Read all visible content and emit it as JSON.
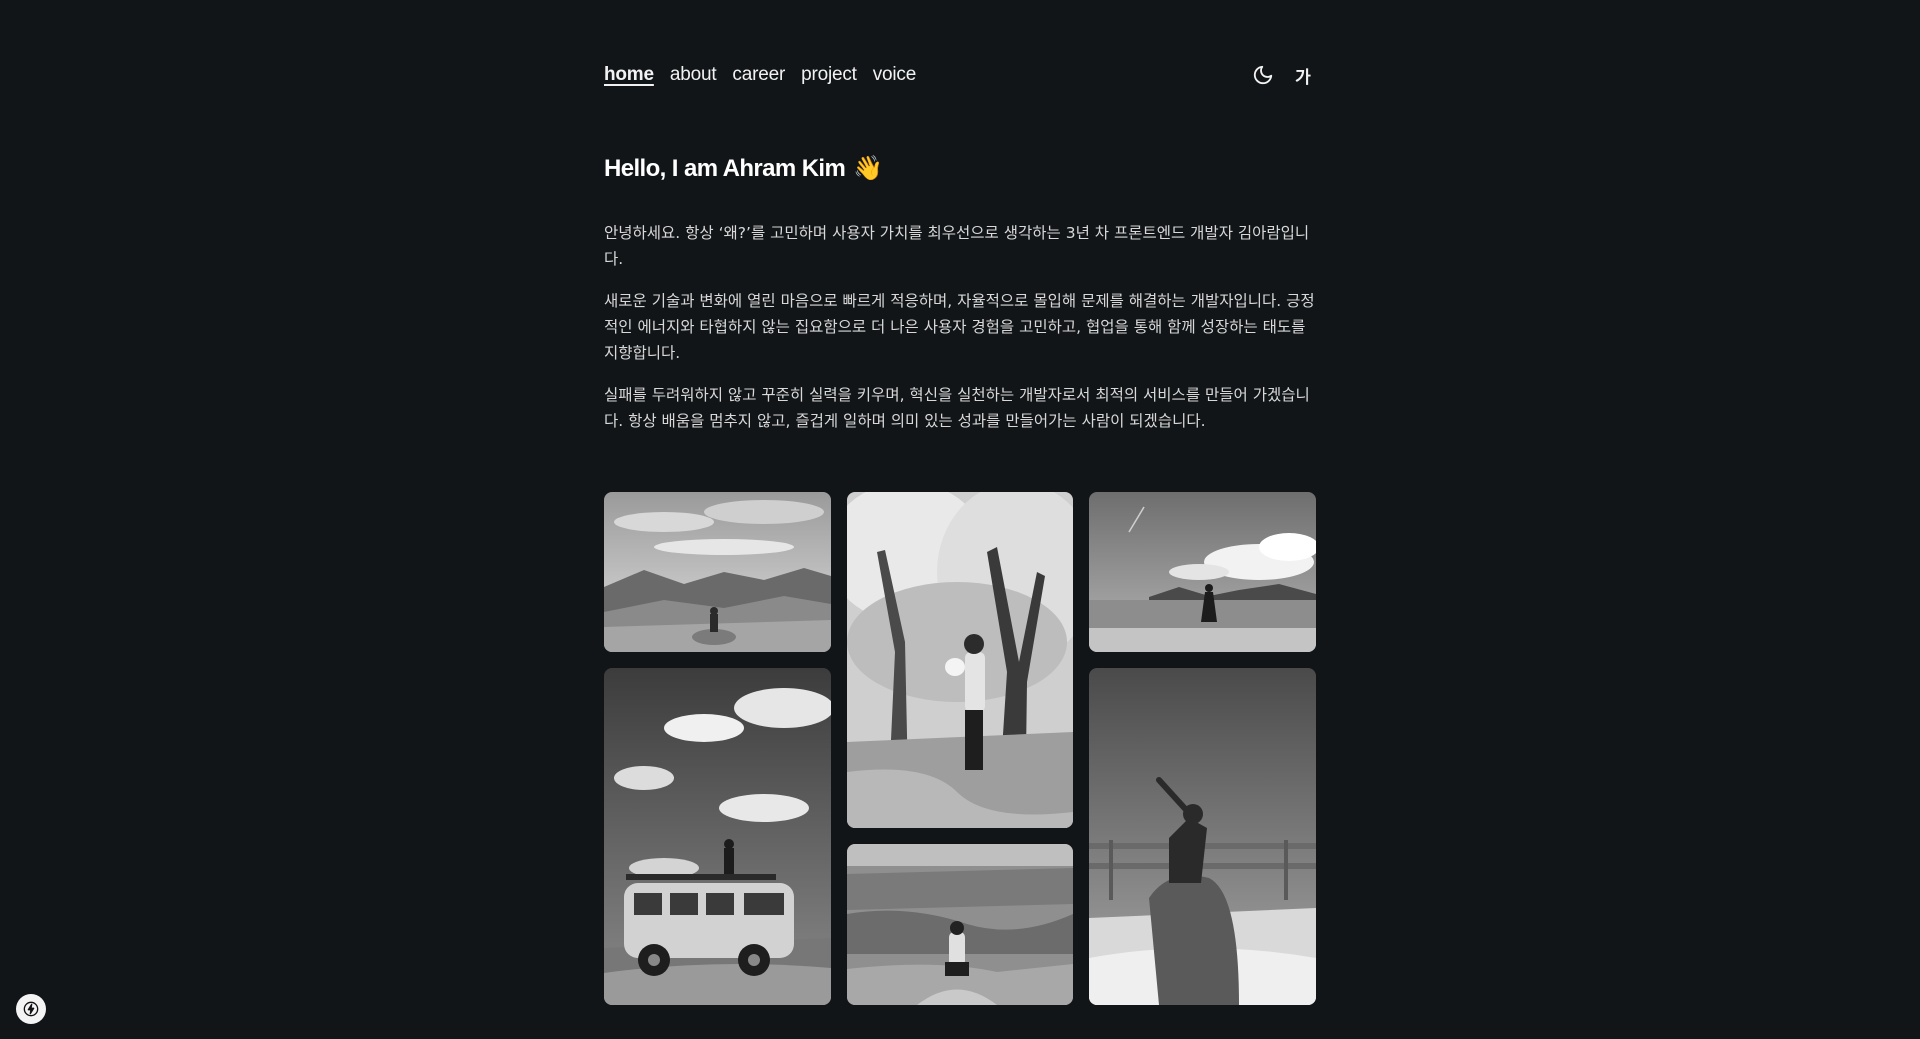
{
  "nav": {
    "links": [
      {
        "label": "home",
        "active": true
      },
      {
        "label": "about"
      },
      {
        "label": "career"
      },
      {
        "label": "project"
      },
      {
        "label": "voice"
      }
    ],
    "theme_icon": "moon-icon",
    "lang_label": "가"
  },
  "hero": {
    "title": "Hello, I am Ahram Kim",
    "emoji": "👋"
  },
  "intro": {
    "paragraphs": [
      "안녕하세요. 항상 ‘왜?’를 고민하며 사용자 가치를 최우선으로 생각하는 3년 차 프론트엔드 개발자 김아람입니다.",
      "새로운 기술과 변화에 열린 마음으로 빠르게 적응하며, 자율적으로 몰입해 문제를 해결하는 개발자입니다. 긍정적인 에너지와 타협하지 않는 집요함으로 더 나은 사용자 경험을 고민하고, 협업을 통해 함께 성장하는 태도를 지향합니다.",
      "실패를 두려워하지 않고 꾸준히 실력을 키우며, 혁신을 실천하는 개발자로서 최적의 서비스를 만들어 가겠습니다. 항상 배움을 멈추지 않고, 즐겁게 일하며 의미 있는 성과를 만들어가는 사람이 되겠습니다."
    ]
  },
  "gallery": {
    "photos": [
      {
        "name": "photo-mountain-valley"
      },
      {
        "name": "photo-cherry-blossom-tree"
      },
      {
        "name": "photo-beach-lake"
      },
      {
        "name": "photo-van-on-hill"
      },
      {
        "name": "photo-canyon-view"
      },
      {
        "name": "photo-summit-stone"
      }
    ]
  },
  "badge_icon": "bolt-icon",
  "colors": {
    "background": "#111518",
    "text": "#e8e8e8"
  }
}
